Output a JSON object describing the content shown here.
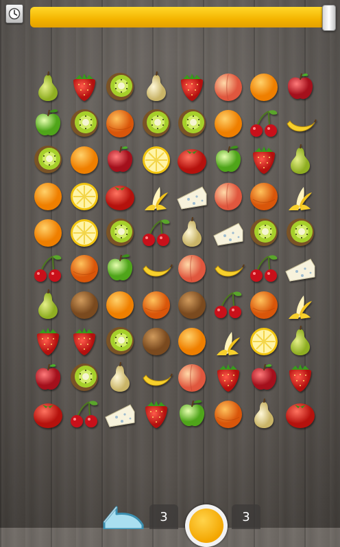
{
  "timer": {
    "progress": 0.97,
    "color": "#f4b400"
  },
  "toolbar": {
    "clock_icon": "clock-icon"
  },
  "board": {
    "rows": 10,
    "cols": 8,
    "tiles": [
      [
        "pear",
        "strawberry",
        "kiwi",
        "pear-pale",
        "strawberry",
        "peach",
        "orange",
        "apple-red"
      ],
      [
        "apple-green",
        "kiwi",
        "orange-blood",
        "kiwi",
        "kiwi",
        "orange",
        "cherries",
        "banana"
      ],
      [
        "kiwi",
        "orange",
        "apple-red",
        "lemon",
        "tomato",
        "apple-green",
        "strawberry",
        "pear"
      ],
      [
        "orange",
        "lemon",
        "tomato",
        "banana-peeled",
        "cheese",
        "peach",
        "orange-blood",
        "banana-peeled"
      ],
      [
        "orange",
        "lemon",
        "kiwi",
        "cherries",
        "pear-pale",
        "cheese",
        "kiwi",
        "kiwi"
      ],
      [
        "cherries",
        "orange-blood",
        "apple-green",
        "banana",
        "peach",
        "banana",
        "cherries",
        "cheese"
      ],
      [
        "pear",
        "coconut",
        "orange",
        "orange-blood",
        "coconut",
        "cherries",
        "orange-blood",
        "banana-peeled"
      ],
      [
        "strawberry",
        "strawberry",
        "kiwi",
        "coconut",
        "orange",
        "banana-peeled",
        "lemon",
        "pear"
      ],
      [
        "apple-red",
        "kiwi",
        "pear-pale",
        "banana",
        "peach",
        "strawberry",
        "apple-red",
        "strawberry"
      ],
      [
        "tomato",
        "cherries",
        "cheese",
        "strawberry",
        "apple-green",
        "orange-blood",
        "pear-pale",
        "tomato"
      ]
    ]
  },
  "bottom": {
    "shuffle_icon": "back-arrow-icon",
    "shuffle_count": "3",
    "hint_icon": "hint-circle-icon",
    "hint_count": "3"
  }
}
